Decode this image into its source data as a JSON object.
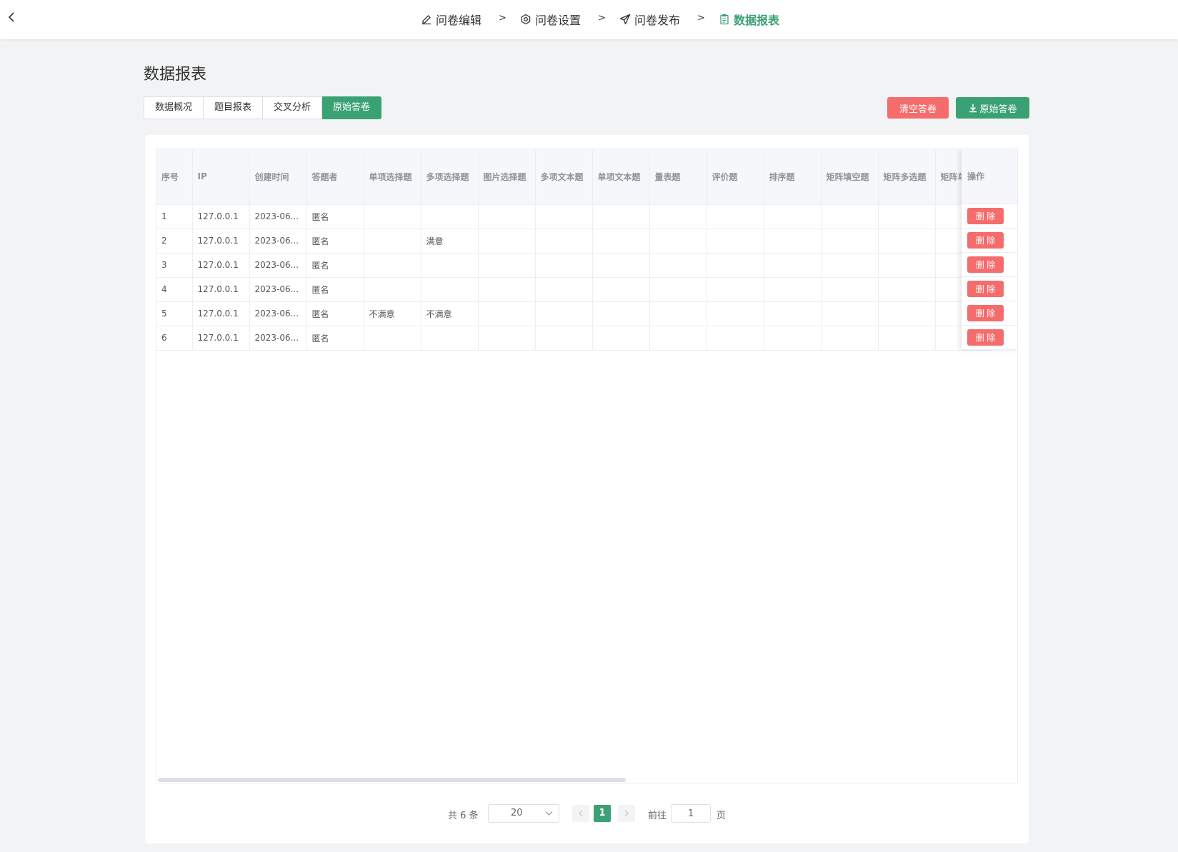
{
  "nav": {
    "steps": [
      {
        "label": "问卷编辑",
        "icon": "pencil-icon"
      },
      {
        "label": "问卷设置",
        "icon": "gear-icon"
      },
      {
        "label": "问卷发布",
        "icon": "send-icon"
      },
      {
        "label": "数据报表",
        "icon": "clipboard-icon",
        "active": true
      }
    ],
    "separator": ">"
  },
  "page_title": "数据报表",
  "tabs": [
    {
      "label": "数据概况"
    },
    {
      "label": "题目报表"
    },
    {
      "label": "交叉分析"
    },
    {
      "label": "原始答卷",
      "active": true
    }
  ],
  "actions": {
    "clear_label": "清空答卷",
    "export_label": "原始答卷"
  },
  "table": {
    "columns": [
      "序号",
      "IP",
      "创建时间",
      "答题者",
      "单项选择题",
      "多项选择题",
      "图片选择题",
      "多项文本题",
      "单项文本题",
      "量表题",
      "评价题",
      "排序题",
      "矩阵填空题",
      "矩阵多选题",
      "矩阵单"
    ],
    "op_header": "操作",
    "delete_label": "删 除",
    "rows": [
      [
        "1",
        "127.0.0.1",
        "2023-06...",
        "匿名",
        "",
        "",
        "",
        "",
        "",
        "",
        "",
        "",
        "",
        "",
        ""
      ],
      [
        "2",
        "127.0.0.1",
        "2023-06...",
        "匿名",
        "",
        "满意",
        "",
        "",
        "",
        "",
        "",
        "",
        "",
        "",
        ""
      ],
      [
        "3",
        "127.0.0.1",
        "2023-06...",
        "匿名",
        "",
        "",
        "",
        "",
        "",
        "",
        "",
        "",
        "",
        "",
        ""
      ],
      [
        "4",
        "127.0.0.1",
        "2023-06...",
        "匿名",
        "",
        "",
        "",
        "",
        "",
        "",
        "",
        "",
        "",
        "",
        ""
      ],
      [
        "5",
        "127.0.0.1",
        "2023-06...",
        "匿名",
        "不满意",
        "不满意",
        "",
        "",
        "",
        "",
        "",
        "",
        "",
        "",
        ""
      ],
      [
        "6",
        "127.0.0.1",
        "2023-06...",
        "匿名",
        "",
        "",
        "",
        "",
        "",
        "",
        "",
        "",
        "",
        "",
        ""
      ]
    ]
  },
  "pagination": {
    "total": "共 6 条",
    "page_size": "20",
    "current_page": "1",
    "goto_label": "前往",
    "goto_value": "1",
    "page_suffix": "页"
  },
  "colors": {
    "primary": "#3aa173",
    "danger": "#f56c6c"
  }
}
